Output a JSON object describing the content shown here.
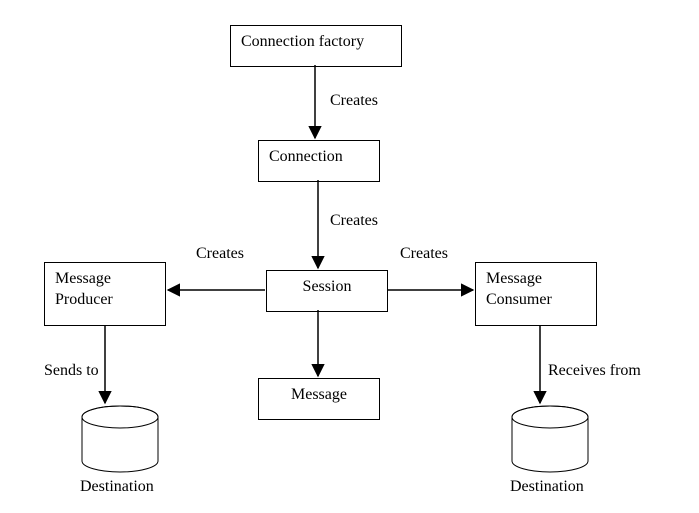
{
  "boxes": {
    "connection_factory": "Connection factory",
    "connection": "Connection",
    "session": "Session",
    "message_producer_l1": "Message",
    "message_producer_l2": "Producer",
    "message_consumer_l1": "Message",
    "message_consumer_l2": "Consumer",
    "message": "Message"
  },
  "edges": {
    "factory_to_connection": "Creates",
    "connection_to_session": "Creates",
    "session_to_producer": "Creates",
    "session_to_consumer": "Creates",
    "producer_to_dest": "Sends to",
    "consumer_from_dest": "Receives from"
  },
  "cylinders": {
    "left": "Destination",
    "right": "Destination"
  }
}
